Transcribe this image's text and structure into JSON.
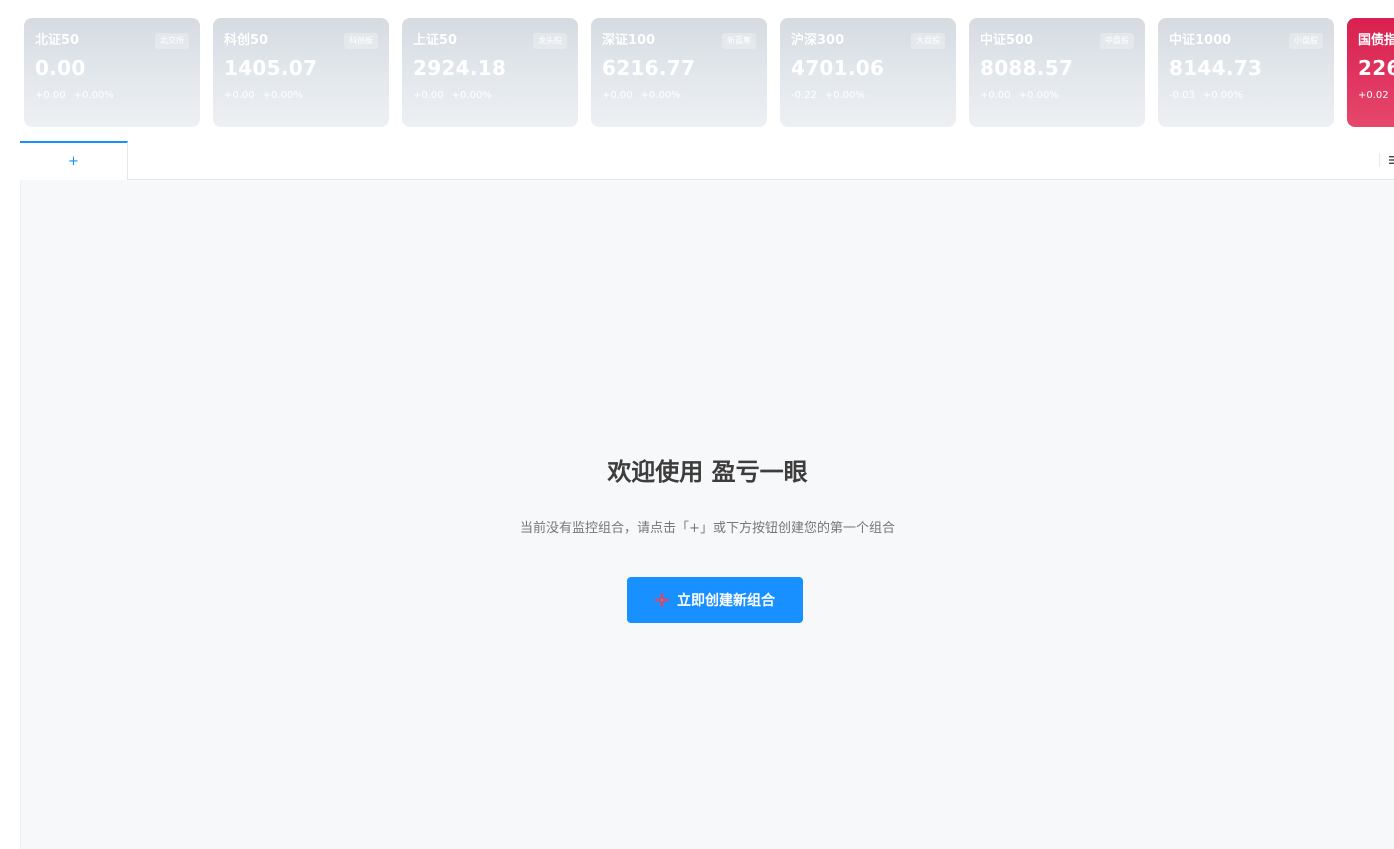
{
  "colors": {
    "accent": "#1890ff",
    "card_gray": "#dde2e7",
    "card_red": "#dc2a55",
    "plus_icon": "#e0455f"
  },
  "tickers": [
    {
      "name": "北证50",
      "badge": "北交所",
      "value": "0.00",
      "change": "+0.00",
      "change_pct": "+0.00%"
    },
    {
      "name": "科创50",
      "badge": "科创板",
      "value": "1405.07",
      "change": "+0.00",
      "change_pct": "+0.00%"
    },
    {
      "name": "上证50",
      "badge": "龙头股",
      "value": "2924.18",
      "change": "+0.00",
      "change_pct": "+0.00%"
    },
    {
      "name": "深证100",
      "badge": "新蓝筹",
      "value": "6216.77",
      "change": "+0.00",
      "change_pct": "+0.00%"
    },
    {
      "name": "沪深300",
      "badge": "大盘股",
      "value": "4701.06",
      "change": "-0.22",
      "change_pct": "+0.00%"
    },
    {
      "name": "中证500",
      "badge": "中盘股",
      "value": "8088.57",
      "change": "+0.00",
      "change_pct": "+0.00%"
    },
    {
      "name": "中证1000",
      "badge": "小盘股",
      "value": "8144.73",
      "change": "-0.03",
      "change_pct": "+0.00%"
    },
    {
      "name": "国债指",
      "badge": "",
      "value": "226",
      "change": "+0.02",
      "change_pct": ""
    }
  ],
  "tabs": {
    "add_label": "+",
    "menu_icon": "menu-icon"
  },
  "main": {
    "title": "欢迎使用 盈亏一眼",
    "subtitle": "当前没有监控组合，请点击「+」或下方按钮创建您的第一个组合",
    "create_button_label": "立即创建新组合",
    "create_button_icon": "plus-icon"
  }
}
